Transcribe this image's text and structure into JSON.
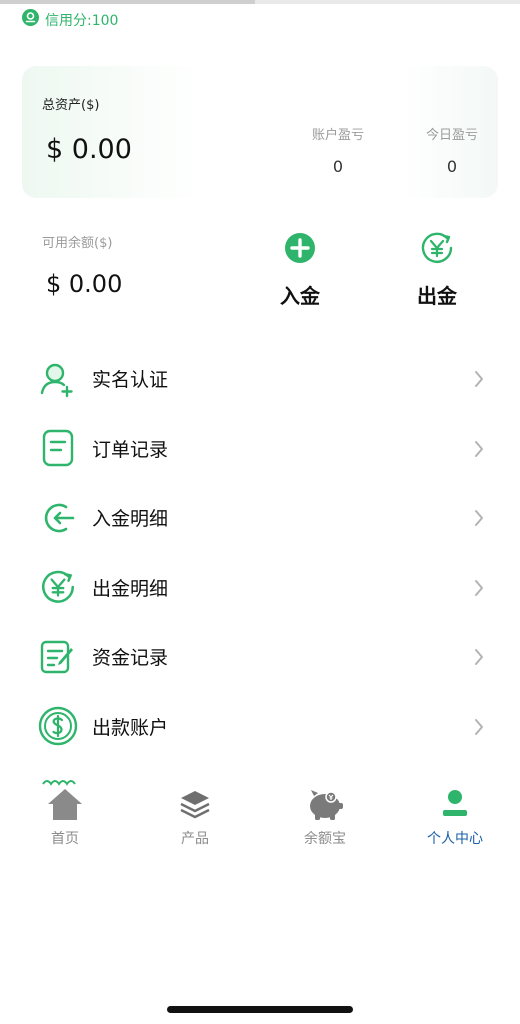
{
  "credit": {
    "label": "信用分:100",
    "icon": "credit-badge-icon"
  },
  "assets": {
    "total_label": "总资产($)",
    "total_value": "$ 0.00",
    "account_pnl_label": "账户盈亏",
    "account_pnl_value": "0",
    "today_pnl_label": "今日盈亏",
    "today_pnl_value": "0",
    "available_label": "可用余额($)",
    "available_value": "$ 0.00"
  },
  "actions": [
    {
      "label": "入金",
      "icon": "plus-circle-icon"
    },
    {
      "label": "出金",
      "icon": "yen-exchange-icon"
    }
  ],
  "menu": {
    "items": [
      {
        "label": "实名认证",
        "icon": "user-add-icon"
      },
      {
        "label": "订单记录",
        "icon": "document-icon"
      },
      {
        "label": "入金明细",
        "icon": "deposit-arrow-icon"
      },
      {
        "label": "出金明细",
        "icon": "yen-exchange-icon"
      },
      {
        "label": "资金记录",
        "icon": "edit-note-icon"
      },
      {
        "label": "出款账户",
        "icon": "dollar-coin-icon"
      }
    ]
  },
  "tabbar": {
    "items": [
      {
        "label": "首页",
        "icon": "home-icon",
        "active": false
      },
      {
        "label": "产品",
        "icon": "layers-icon",
        "active": false
      },
      {
        "label": "余额宝",
        "icon": "piggy-bank-icon",
        "active": false
      },
      {
        "label": "个人中心",
        "icon": "person-icon",
        "active": true
      }
    ]
  },
  "colors": {
    "accent": "#2fb56b",
    "active_tab": "#1a5fa8",
    "muted": "#9b9b9b"
  }
}
